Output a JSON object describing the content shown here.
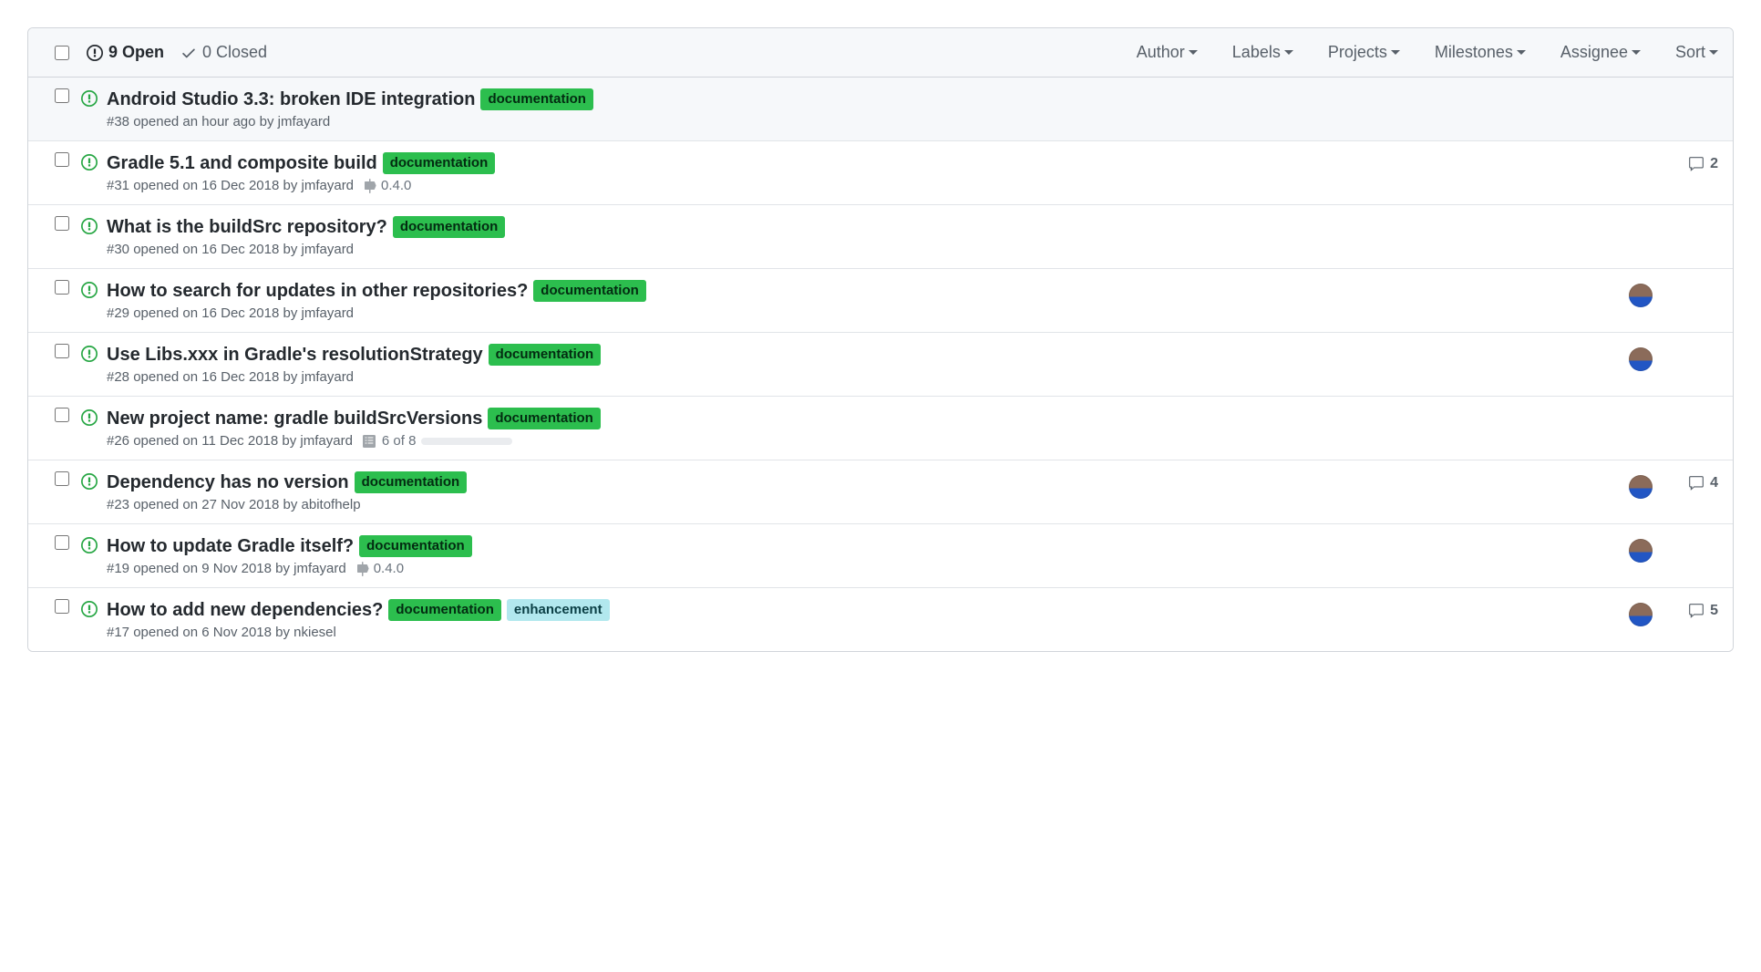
{
  "header": {
    "open_count": "9 Open",
    "closed_count": "0 Closed",
    "filters": [
      "Author",
      "Labels",
      "Projects",
      "Milestones",
      "Assignee",
      "Sort"
    ]
  },
  "labels": {
    "documentation": "documentation",
    "enhancement": "enhancement"
  },
  "issues": [
    {
      "title": "Android Studio 3.3: broken IDE integration",
      "labels": [
        "documentation"
      ],
      "meta": "#38 opened an hour ago by jmfayard",
      "hovered": true,
      "assignee": false,
      "comments": null,
      "milestone": null,
      "tasks": null
    },
    {
      "title": "Gradle 5.1 and composite build",
      "labels": [
        "documentation"
      ],
      "meta": "#31 opened on 16 Dec 2018 by jmfayard",
      "assignee": false,
      "comments": "2",
      "milestone": "0.4.0",
      "tasks": null
    },
    {
      "title": "What is the buildSrc repository?",
      "labels": [
        "documentation"
      ],
      "meta": "#30 opened on 16 Dec 2018 by jmfayard",
      "assignee": false,
      "comments": null,
      "milestone": null,
      "tasks": null
    },
    {
      "title": "How to search for updates in other repositories?",
      "labels": [
        "documentation"
      ],
      "meta": "#29 opened on 16 Dec 2018 by jmfayard",
      "assignee": true,
      "comments": null,
      "milestone": null,
      "tasks": null
    },
    {
      "title": "Use Libs.xxx in Gradle's resolutionStrategy",
      "labels": [
        "documentation"
      ],
      "meta": "#28 opened on 16 Dec 2018 by jmfayard",
      "assignee": true,
      "comments": null,
      "milestone": null,
      "tasks": null
    },
    {
      "title": "New project name: gradle buildSrcVersions",
      "labels": [
        "documentation"
      ],
      "meta": "#26 opened on 11 Dec 2018 by jmfayard",
      "assignee": false,
      "comments": null,
      "milestone": null,
      "tasks": "6 of 8"
    },
    {
      "title": "Dependency has no version",
      "labels": [
        "documentation"
      ],
      "meta": "#23 opened on 27 Nov 2018 by abitofhelp",
      "assignee": true,
      "comments": "4",
      "milestone": null,
      "tasks": null
    },
    {
      "title": "How to update Gradle itself?",
      "labels": [
        "documentation"
      ],
      "meta": "#19 opened on 9 Nov 2018 by jmfayard",
      "assignee": true,
      "comments": null,
      "milestone": "0.4.0",
      "tasks": null
    },
    {
      "title": "How to add new dependencies?",
      "labels": [
        "documentation",
        "enhancement"
      ],
      "meta": "#17 opened on 6 Nov 2018 by nkiesel",
      "assignee": true,
      "comments": "5",
      "milestone": null,
      "tasks": null
    }
  ]
}
